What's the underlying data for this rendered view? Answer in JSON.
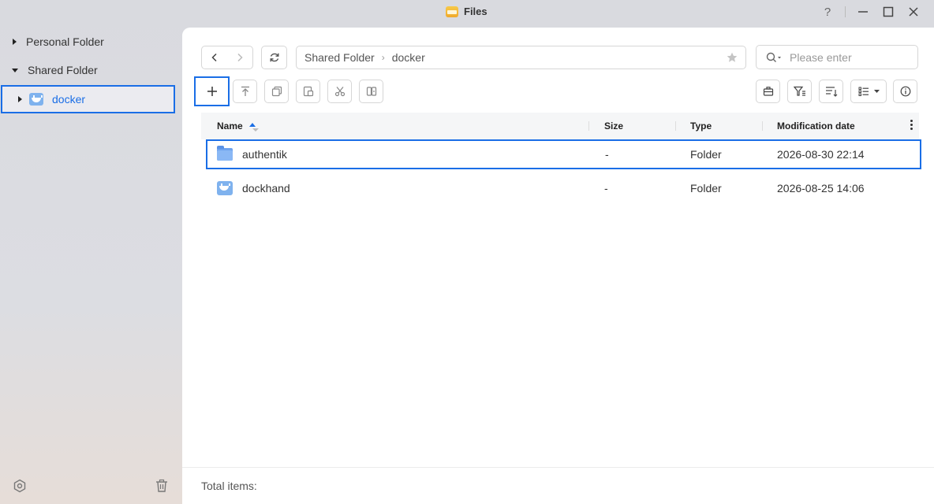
{
  "window": {
    "title": "Files",
    "help_label": "?",
    "minimize_label": "—",
    "maximize_label": "□",
    "close_label": "✕"
  },
  "sidebar": {
    "items": [
      {
        "label": "Personal Folder",
        "expanded": false
      },
      {
        "label": "Shared Folder",
        "expanded": true
      },
      {
        "label": "docker",
        "expanded": false,
        "selected": true
      }
    ]
  },
  "toolbar": {
    "path": [
      "Shared Folder",
      "docker"
    ],
    "search_placeholder": "Please enter",
    "add_label": "+"
  },
  "table": {
    "columns": [
      "Name",
      "Size",
      "Type",
      "Modification date"
    ],
    "sort": {
      "column": "Name",
      "direction": "ascending"
    },
    "rows": [
      {
        "name": "authentik",
        "size": "-",
        "type": "Folder",
        "modified": "2026-08-30 22:14",
        "icon": "folder-icon"
      },
      {
        "name": "dockhand",
        "size": "-",
        "type": "Folder",
        "modified": "2026-08-25 14:06",
        "icon": "docker-folder-icon"
      }
    ]
  },
  "footer": {
    "total_label": "Total items:"
  },
  "colors": {
    "accent": "#1a6ee6",
    "folder": "#6fa3ee"
  }
}
